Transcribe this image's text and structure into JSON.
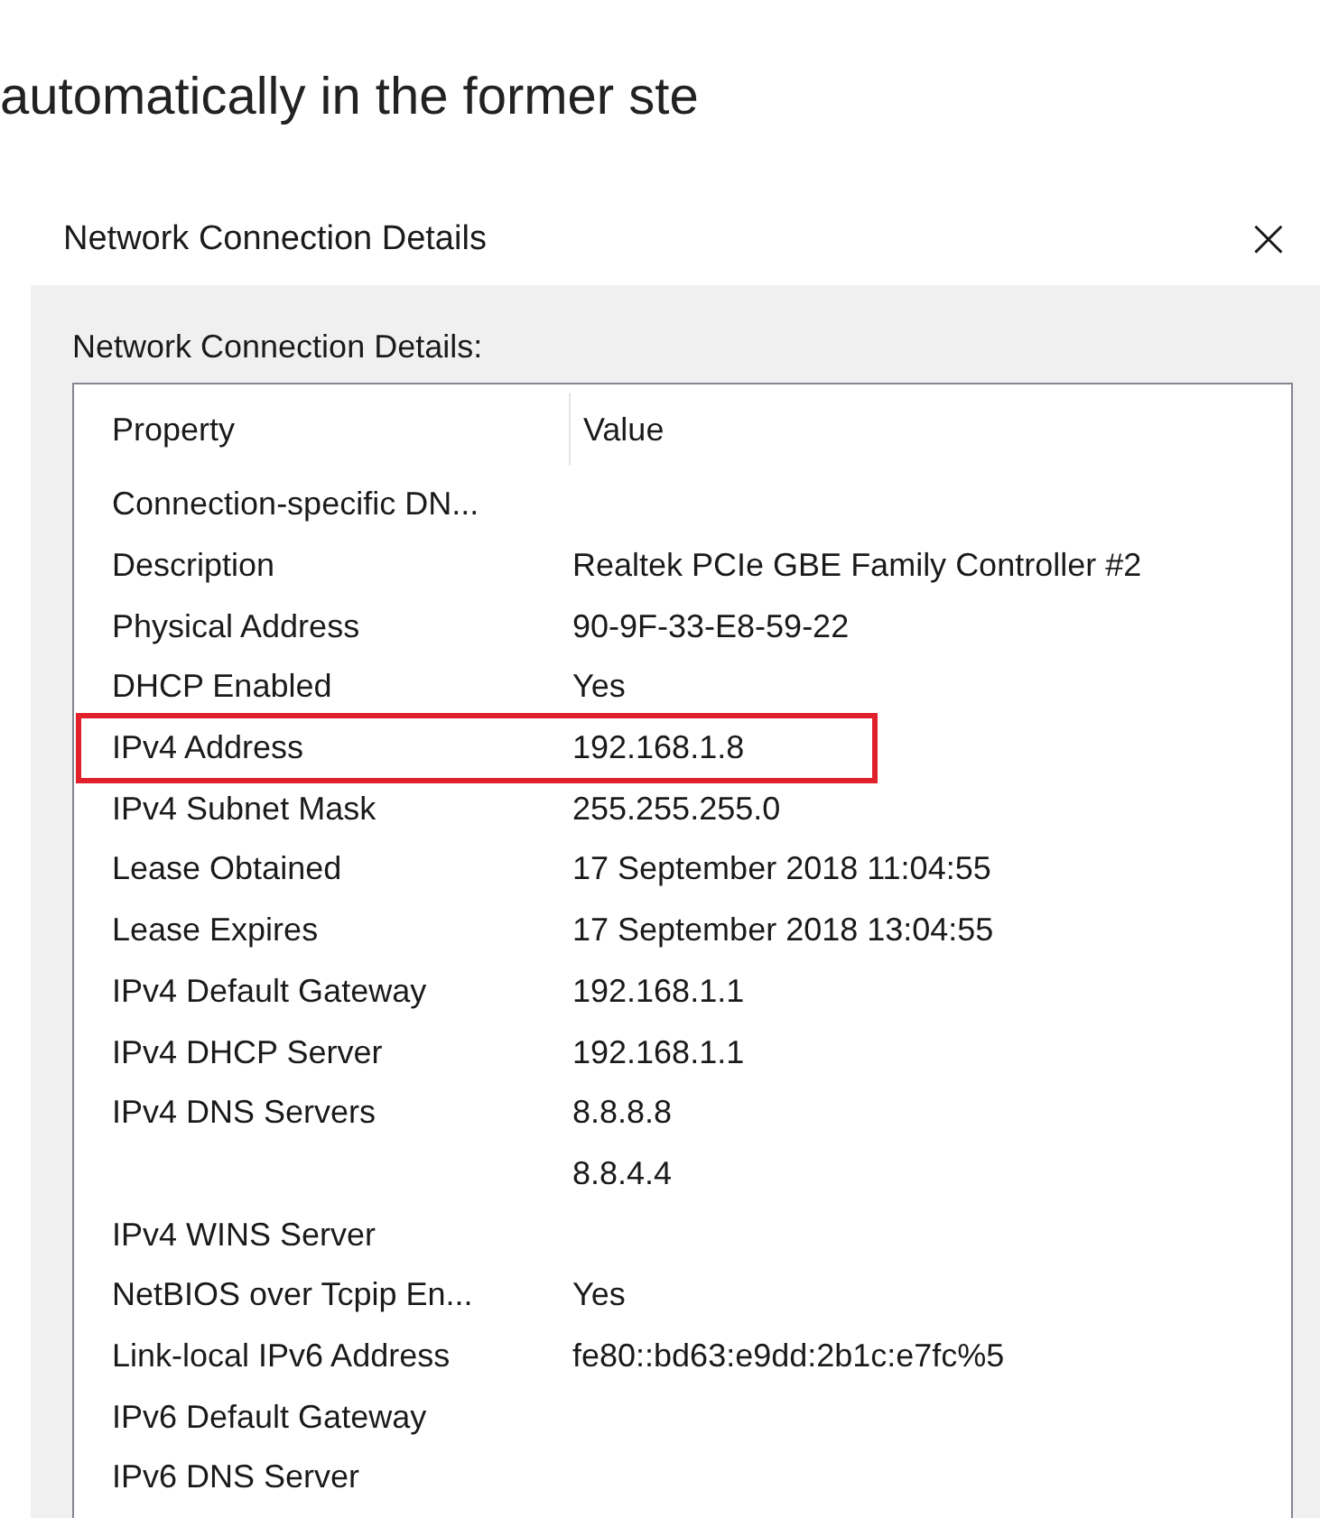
{
  "document_text": "automatically in the former ste",
  "dialog": {
    "title": "Network Connection Details",
    "close": "×",
    "group_label": "Network Connection Details:",
    "table": {
      "columns": [
        "Property",
        "Value"
      ],
      "rows": [
        {
          "property": "Connection-specific DN...",
          "highlighted": false
        },
        {
          "property": "Description",
          "value": "Realtek PCIe GBE Family Controller #2",
          "highlighted": false
        },
        {
          "property": "Physical Address",
          "value": "90-9F-33-E8-59-22",
          "highlighted": false
        },
        {
          "property": "DHCP Enabled",
          "value": "Yes",
          "highlighted": false
        },
        {
          "property": "IPv4 Address",
          "value": "192.168.1.8",
          "highlighted": true
        },
        {
          "property": "IPv4 Subnet Mask",
          "value": "255.255.255.0",
          "highlighted": false
        },
        {
          "property": "Lease Obtained",
          "value": "17 September 2018 11:04:55",
          "highlighted": false
        },
        {
          "property": "Lease Expires",
          "value": "17 September 2018 13:04:55",
          "highlighted": false
        },
        {
          "property": "IPv4 Default Gateway",
          "value": "192.168.1.1",
          "highlighted": false
        },
        {
          "property": "IPv4 DHCP Server",
          "value": "192.168.1.1",
          "highlighted": false
        },
        {
          "property": "IPv4 DNS Servers",
          "value": "8.8.8.8",
          "highlighted": false
        },
        {
          "value": "8.8.4.4",
          "highlighted": false
        },
        {
          "property": "IPv4 WINS Server",
          "highlighted": false
        },
        {
          "property": "NetBIOS over Tcpip En...",
          "value": "Yes",
          "highlighted": false
        },
        {
          "property": "Link-local IPv6 Address",
          "value": "fe80::bd63:e9dd:2b1c:e7fc%5",
          "highlighted": false
        },
        {
          "property": "IPv6 Default Gateway",
          "highlighted": false
        },
        {
          "property": "IPv6 DNS Server",
          "highlighted": false
        }
      ]
    }
  }
}
